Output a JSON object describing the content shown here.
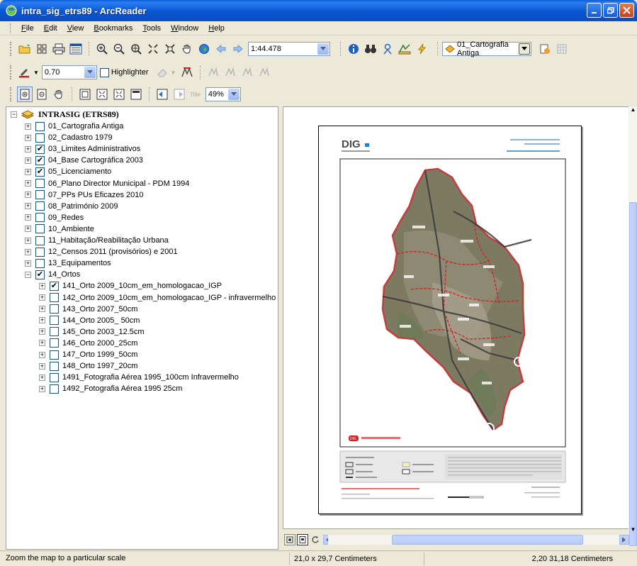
{
  "window": {
    "title": "intra_sig_etrs89 - ArcReader"
  },
  "menu": [
    {
      "label": "File",
      "key": "F"
    },
    {
      "label": "Edit",
      "key": "E"
    },
    {
      "label": "View",
      "key": "V"
    },
    {
      "label": "Bookmarks",
      "key": "B"
    },
    {
      "label": "Tools",
      "key": "T"
    },
    {
      "label": "Window",
      "key": "W"
    },
    {
      "label": "Help",
      "key": "H"
    }
  ],
  "toolbar": {
    "scale_value": "1:44.478",
    "layer_dropdown_value": "01_Cartografia Antiga",
    "line_width_value": "0.70",
    "highlighter_label": "Highlighter",
    "zoom_percent_value": "49%",
    "title_button_label": "Title"
  },
  "toc": {
    "root_label": "INTRASIG (ETRS89)",
    "layers": [
      {
        "label": "01_Cartografia Antiga",
        "checked": false,
        "expander": "+",
        "level": 1
      },
      {
        "label": "02_Cadastro 1979",
        "checked": false,
        "expander": "+",
        "level": 1
      },
      {
        "label": "03_Limites Administrativos",
        "checked": true,
        "expander": "+",
        "level": 1
      },
      {
        "label": "04_Base Cartográfica 2003",
        "checked": true,
        "expander": "+",
        "level": 1
      },
      {
        "label": "05_Licenciamento",
        "checked": true,
        "expander": "+",
        "level": 1
      },
      {
        "label": "06_Plano Director Municipal - PDM 1994",
        "checked": false,
        "expander": "+",
        "level": 1
      },
      {
        "label": "07_PPs PUs Eficazes 2010",
        "checked": false,
        "expander": "+",
        "level": 1
      },
      {
        "label": "08_Património 2009",
        "checked": false,
        "expander": "+",
        "level": 1
      },
      {
        "label": "09_Redes",
        "checked": false,
        "expander": "+",
        "level": 1
      },
      {
        "label": "10_Ambiente",
        "checked": false,
        "expander": "+",
        "level": 1
      },
      {
        "label": "11_Habitação/Reabilitação Urbana",
        "checked": false,
        "expander": "+",
        "level": 1
      },
      {
        "label": "12_Censos 2011 (provisórios) e 2001",
        "checked": false,
        "expander": "+",
        "level": 1
      },
      {
        "label": "13_Equipamentos",
        "checked": false,
        "expander": "+",
        "level": 1
      },
      {
        "label": "14_Ortos",
        "checked": true,
        "expander": "−",
        "level": 1
      },
      {
        "label": "141_Orto 2009_10cm_em_homologacao_IGP",
        "checked": true,
        "expander": "+",
        "level": 2
      },
      {
        "label": "142_Orto 2009_10cm_em_homologacao_IGP - infravermelho",
        "checked": false,
        "expander": "+",
        "level": 2
      },
      {
        "label": "143_Orto 2007_50cm",
        "checked": false,
        "expander": "+",
        "level": 2
      },
      {
        "label": "144_Orto 2005_ 50cm",
        "checked": false,
        "expander": "+",
        "level": 2
      },
      {
        "label": "145_Orto 2003_12.5cm",
        "checked": false,
        "expander": "+",
        "level": 2
      },
      {
        "label": "146_Orto 2000_25cm",
        "checked": false,
        "expander": "+",
        "level": 2
      },
      {
        "label": "147_Orto 1999_50cm",
        "checked": false,
        "expander": "+",
        "level": 2
      },
      {
        "label": "148_Orto 1997_20cm",
        "checked": false,
        "expander": "+",
        "level": 2
      },
      {
        "label": "1491_Fotografia Aérea 1995_100cm Infravermelho",
        "checked": false,
        "expander": "+",
        "level": 2
      },
      {
        "label": "1492_Fotografia Aérea 1995 25cm",
        "checked": false,
        "expander": "+",
        "level": 2
      }
    ]
  },
  "layout_page": {
    "logo_text": "DIG",
    "legend_badge": "DIG"
  },
  "status": {
    "message": "Zoom the map to a particular scale",
    "page_size": "21,0 x 29,7 Centimeters",
    "coordinates": "2,20  31,18 Centimeters"
  },
  "colors": {
    "titlebar": "#0b56d2",
    "boundary_red": "#d42020",
    "accent_blue": "#1a7fd0"
  }
}
